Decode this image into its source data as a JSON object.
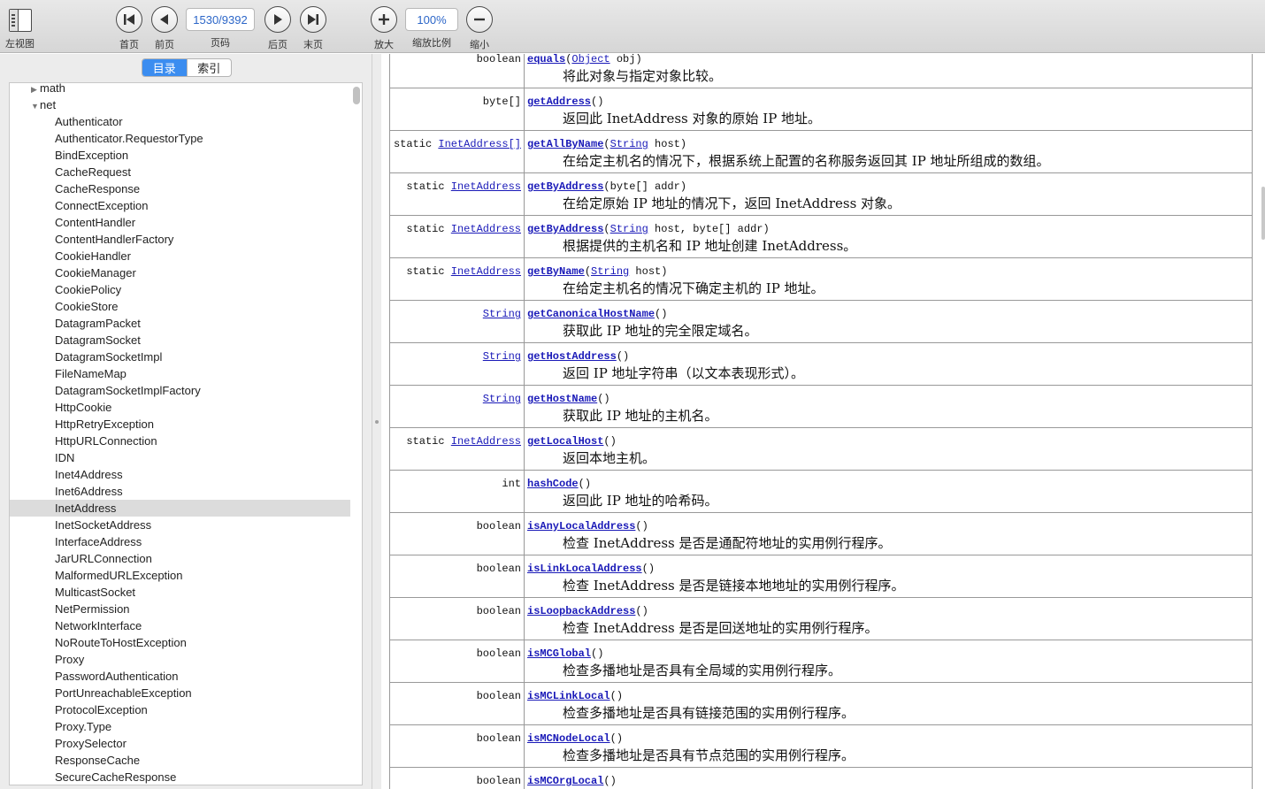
{
  "toolbar": {
    "left_view": "左视图",
    "first": "首页",
    "prev": "前页",
    "page_label": "页码",
    "page_value": "1530/9392",
    "next": "后页",
    "last": "末页",
    "zoom_in": "放大",
    "zoom_label": "缩放比例",
    "zoom_value": "100%",
    "zoom_out": "缩小"
  },
  "sidebar": {
    "tab_toc": "目录",
    "tab_index": "索引",
    "selected": "InetAddress",
    "folders": [
      {
        "label": "math",
        "expanded": false
      },
      {
        "label": "net",
        "expanded": true
      }
    ],
    "items": [
      "Authenticator",
      "Authenticator.RequestorType",
      "BindException",
      "CacheRequest",
      "CacheResponse",
      "ConnectException",
      "ContentHandler",
      "ContentHandlerFactory",
      "CookieHandler",
      "CookieManager",
      "CookiePolicy",
      "CookieStore",
      "DatagramPacket",
      "DatagramSocket",
      "DatagramSocketImpl",
      "FileNameMap",
      "DatagramSocketImplFactory",
      "HttpCookie",
      "HttpRetryException",
      "HttpURLConnection",
      "IDN",
      "Inet4Address",
      "Inet6Address",
      "InetAddress",
      "InetSocketAddress",
      "InterfaceAddress",
      "JarURLConnection",
      "MalformedURLException",
      "MulticastSocket",
      "NetPermission",
      "NetworkInterface",
      "NoRouteToHostException",
      "Proxy",
      "PasswordAuthentication",
      "PortUnreachableException",
      "ProtocolException",
      "Proxy.Type",
      "ProxySelector",
      "ResponseCache",
      "SecureCacheResponse"
    ]
  },
  "methods": [
    {
      "mod": "boolean",
      "mod_type": "",
      "name": "equals",
      "params": [
        {
          "t": "Object",
          "link": true
        },
        {
          "t": " obj",
          "link": false
        }
      ],
      "desc": "将此对象与指定对象比较。"
    },
    {
      "mod": "byte[]",
      "mod_type": "",
      "name": "getAddress",
      "params": [],
      "desc": "返回此 InetAddress 对象的原始 IP 地址。"
    },
    {
      "mod": "static ",
      "mod_type": "InetAddress[]",
      "name": "getAllByName",
      "params": [
        {
          "t": "String",
          "link": true
        },
        {
          "t": " host",
          "link": false
        }
      ],
      "desc": "在给定主机名的情况下，根据系统上配置的名称服务返回其 IP 地址所组成的数组。"
    },
    {
      "mod": "static ",
      "mod_type": "InetAddress",
      "name": "getByAddress",
      "params": [
        {
          "t": "byte[] addr",
          "link": false
        }
      ],
      "desc": "在给定原始 IP 地址的情况下，返回 InetAddress 对象。"
    },
    {
      "mod": "static ",
      "mod_type": "InetAddress",
      "name": "getByAddress",
      "params": [
        {
          "t": "String",
          "link": true
        },
        {
          "t": " host, byte[] addr",
          "link": false
        }
      ],
      "desc": "根据提供的主机名和 IP 地址创建 InetAddress。"
    },
    {
      "mod": "static ",
      "mod_type": "InetAddress",
      "name": "getByName",
      "params": [
        {
          "t": "String",
          "link": true
        },
        {
          "t": " host",
          "link": false
        }
      ],
      "desc": "在给定主机名的情况下确定主机的 IP 地址。"
    },
    {
      "mod": "",
      "mod_type": "String",
      "name": "getCanonicalHostName",
      "params": [],
      "desc": "获取此 IP 地址的完全限定域名。"
    },
    {
      "mod": "",
      "mod_type": "String",
      "name": "getHostAddress",
      "params": [],
      "desc": "返回 IP 地址字符串（以文本表现形式）。"
    },
    {
      "mod": "",
      "mod_type": "String",
      "name": "getHostName",
      "params": [],
      "desc": "获取此 IP 地址的主机名。"
    },
    {
      "mod": "static ",
      "mod_type": "InetAddress",
      "name": "getLocalHost",
      "params": [],
      "desc": "返回本地主机。"
    },
    {
      "mod": "int",
      "mod_type": "",
      "name": "hashCode",
      "params": [],
      "desc": "返回此 IP 地址的哈希码。"
    },
    {
      "mod": "boolean",
      "mod_type": "",
      "name": "isAnyLocalAddress",
      "params": [],
      "desc": "检查 InetAddress 是否是通配符地址的实用例行程序。"
    },
    {
      "mod": "boolean",
      "mod_type": "",
      "name": "isLinkLocalAddress",
      "params": [],
      "desc": "检查 InetAddress 是否是链接本地地址的实用例行程序。"
    },
    {
      "mod": "boolean",
      "mod_type": "",
      "name": "isLoopbackAddress",
      "params": [],
      "desc": "检查 InetAddress 是否是回送地址的实用例行程序。"
    },
    {
      "mod": "boolean",
      "mod_type": "",
      "name": "isMCGlobal",
      "params": [],
      "desc": "检查多播地址是否具有全局域的实用例行程序。"
    },
    {
      "mod": "boolean",
      "mod_type": "",
      "name": "isMCLinkLocal",
      "params": [],
      "desc": "检查多播地址是否具有链接范围的实用例行程序。"
    },
    {
      "mod": "boolean",
      "mod_type": "",
      "name": "isMCNodeLocal",
      "params": [],
      "desc": "检查多播地址是否具有节点范围的实用例行程序。"
    },
    {
      "mod": "boolean",
      "mod_type": "",
      "name": "isMCOrgLocal",
      "params": [],
      "desc": ""
    }
  ]
}
